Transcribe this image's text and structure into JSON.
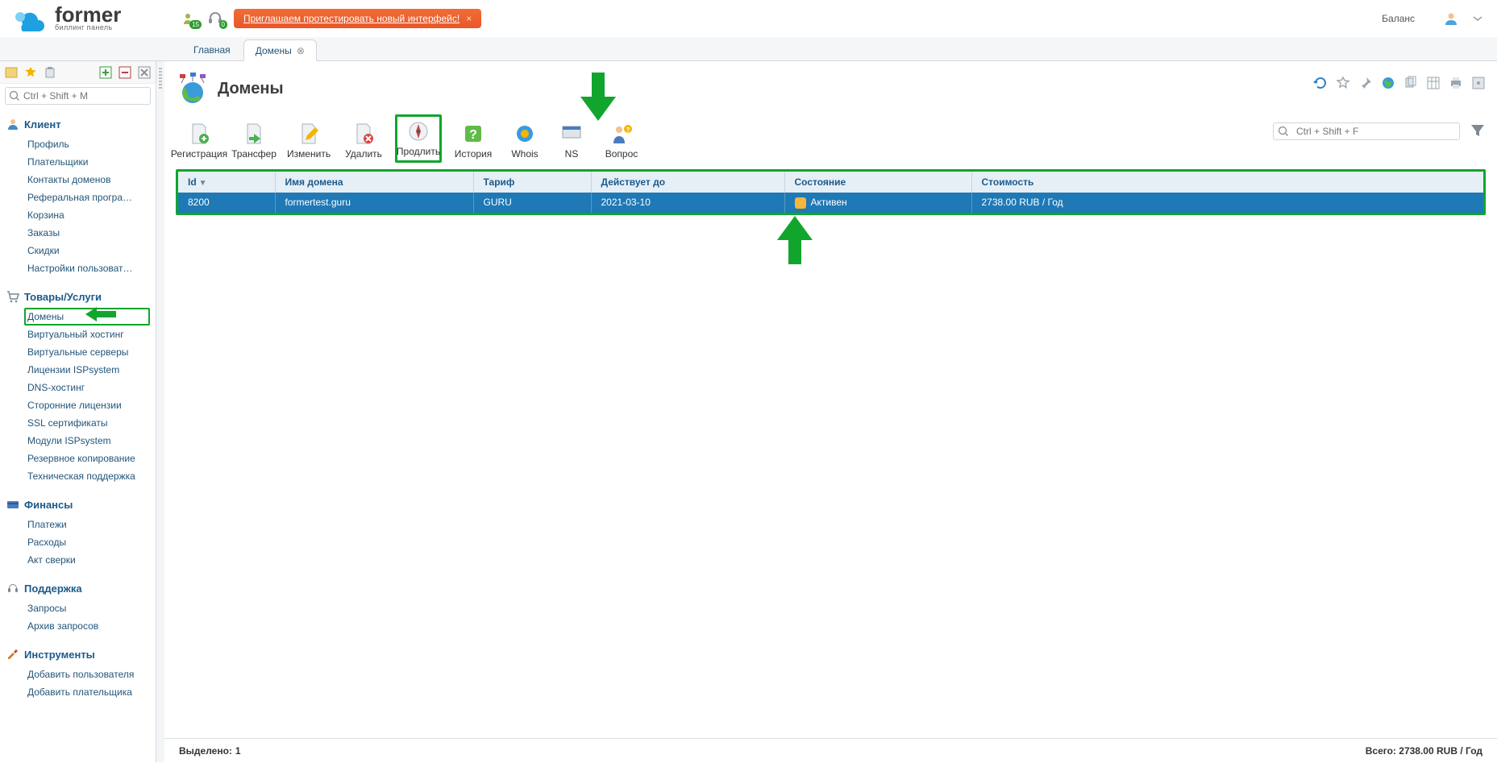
{
  "logo": {
    "brand": "former",
    "sub": "биллинг панель"
  },
  "notice": {
    "text": "Приглашаем протестировать новый интерфейс!"
  },
  "top": {
    "balance_label": "Баланс"
  },
  "tabs": [
    {
      "label": "Главная",
      "active": false,
      "closable": false
    },
    {
      "label": "Домены",
      "active": true,
      "closable": true
    }
  ],
  "search": {
    "placeholder": "Ctrl + Shift + M"
  },
  "grid_search": {
    "placeholder": "Ctrl + Shift + F"
  },
  "sidebar": {
    "client": {
      "title": "Клиент",
      "items": [
        "Профиль",
        "Плательщики",
        "Контакты доменов",
        "Реферальная програ…",
        "Корзина",
        "Заказы",
        "Скидки",
        "Настройки пользоват…"
      ]
    },
    "products": {
      "title": "Товары/Услуги",
      "items": [
        "Домены",
        "Виртуальный хостинг",
        "Виртуальные серверы",
        "Лицензии ISPsystem",
        "DNS-хостинг",
        "Сторонние лицензии",
        "SSL сертификаты",
        "Модули ISPsystem",
        "Резервное копирование",
        "Техническая поддержка"
      ]
    },
    "finance": {
      "title": "Финансы",
      "items": [
        "Платежи",
        "Расходы",
        "Акт сверки"
      ]
    },
    "support": {
      "title": "Поддержка",
      "items": [
        "Запросы",
        "Архив запросов"
      ]
    },
    "tools": {
      "title": "Инструменты",
      "items": [
        "Добавить пользователя",
        "Добавить плательщика"
      ]
    }
  },
  "page": {
    "title": "Домены"
  },
  "toolbar": {
    "register": "Регистрация",
    "transfer": "Трансфер",
    "edit": "Изменить",
    "delete": "Удалить",
    "renew": "Продлить",
    "history": "История",
    "whois": "Whois",
    "ns": "NS",
    "question": "Вопрос"
  },
  "table": {
    "headers": {
      "id": "Id",
      "name": "Имя домена",
      "tariff": "Тариф",
      "expires": "Действует до",
      "state": "Состояние",
      "price": "Стоимость"
    },
    "rows": [
      {
        "id": "8200",
        "name": "formertest.guru",
        "tariff": "GURU",
        "expires": "2021-03-10",
        "state": "Активен",
        "price": "2738.00 RUB / Год"
      }
    ]
  },
  "footer": {
    "selected_label": "Выделено:",
    "selected_count": "1",
    "total_label": "Всего:",
    "total_value": "2738.00 RUB / Год"
  }
}
